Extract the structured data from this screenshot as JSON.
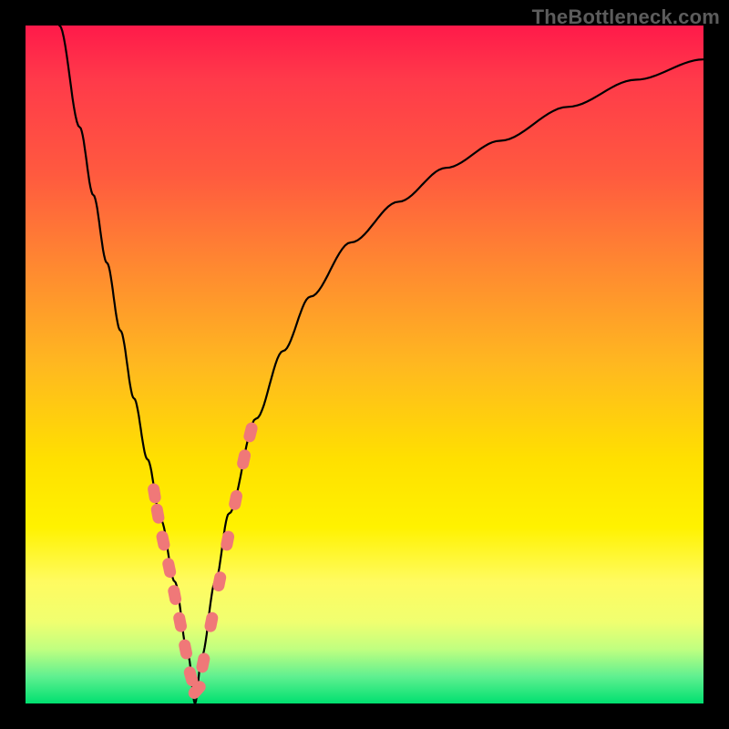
{
  "watermark": "TheBottleneck.com",
  "colors": {
    "frame": "#000000",
    "curve": "#000000",
    "marker_fill": "#f07878",
    "marker_stroke": "#e86868"
  },
  "chart_data": {
    "type": "line",
    "title": "",
    "xlabel": "",
    "ylabel": "",
    "xlim": [
      0,
      100
    ],
    "ylim": [
      0,
      100
    ],
    "x_min_at": 25,
    "series": [
      {
        "name": "bottleneck-curve",
        "x": [
          5,
          8,
          10,
          12,
          14,
          16,
          18,
          20,
          22,
          24,
          25,
          26,
          28,
          30,
          34,
          38,
          42,
          48,
          55,
          62,
          70,
          80,
          90,
          100
        ],
        "y": [
          100,
          85,
          75,
          65,
          55,
          45,
          36,
          27,
          18,
          7,
          0,
          7,
          18,
          28,
          42,
          52,
          60,
          68,
          74,
          79,
          83,
          88,
          92,
          95
        ]
      }
    ],
    "markers": {
      "name": "highlighted-points",
      "x": [
        19.0,
        19.5,
        20.3,
        21.2,
        22.0,
        22.8,
        23.6,
        24.4,
        25.3,
        26.2,
        27.4,
        28.6,
        29.8,
        31.0,
        32.2,
        33.2
      ],
      "y": [
        31,
        28,
        24,
        20,
        16,
        12,
        8,
        4,
        2,
        6,
        12,
        18,
        24,
        30,
        36,
        40
      ]
    }
  }
}
